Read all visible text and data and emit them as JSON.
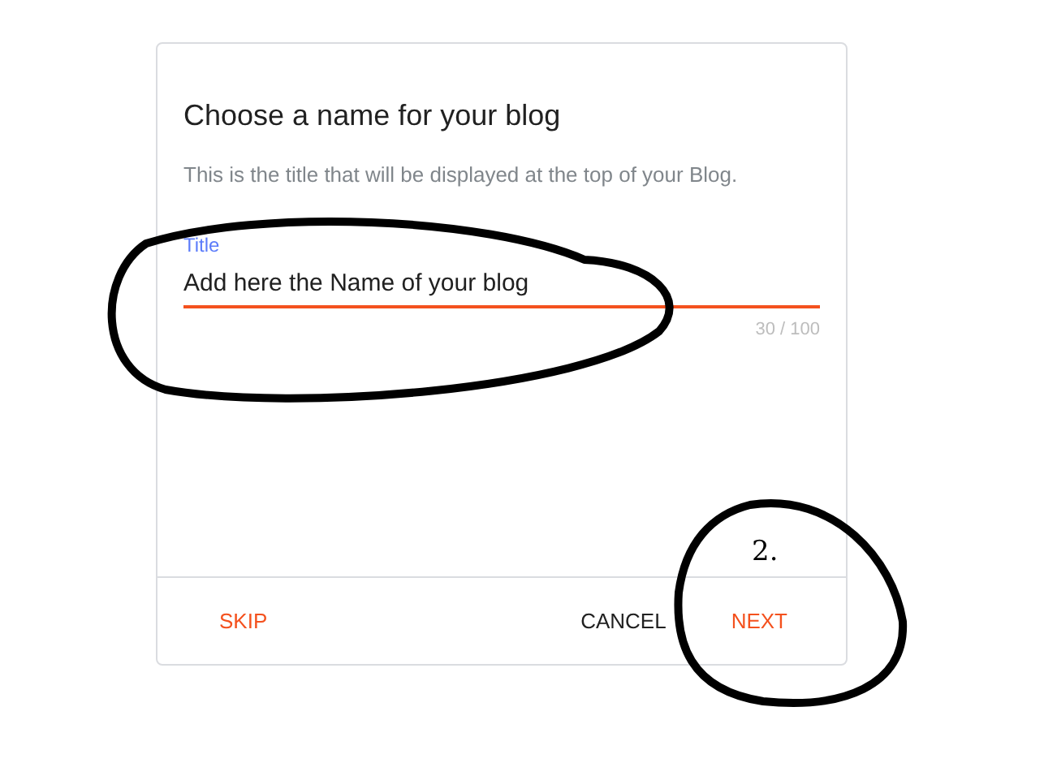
{
  "dialog": {
    "title": "Choose a name for your blog",
    "description": "This is the title that will be displayed at the top of your Blog.",
    "field": {
      "label": "Title",
      "value": "Add here the Name of your blog",
      "counter": "30 / 100",
      "focused": true
    },
    "buttons": [
      {
        "label": "SKIP",
        "kind": "accent"
      },
      {
        "label": "CANCEL",
        "kind": "plain"
      },
      {
        "label": "NEXT",
        "kind": "accent"
      }
    ]
  },
  "annotation_label": "2."
}
